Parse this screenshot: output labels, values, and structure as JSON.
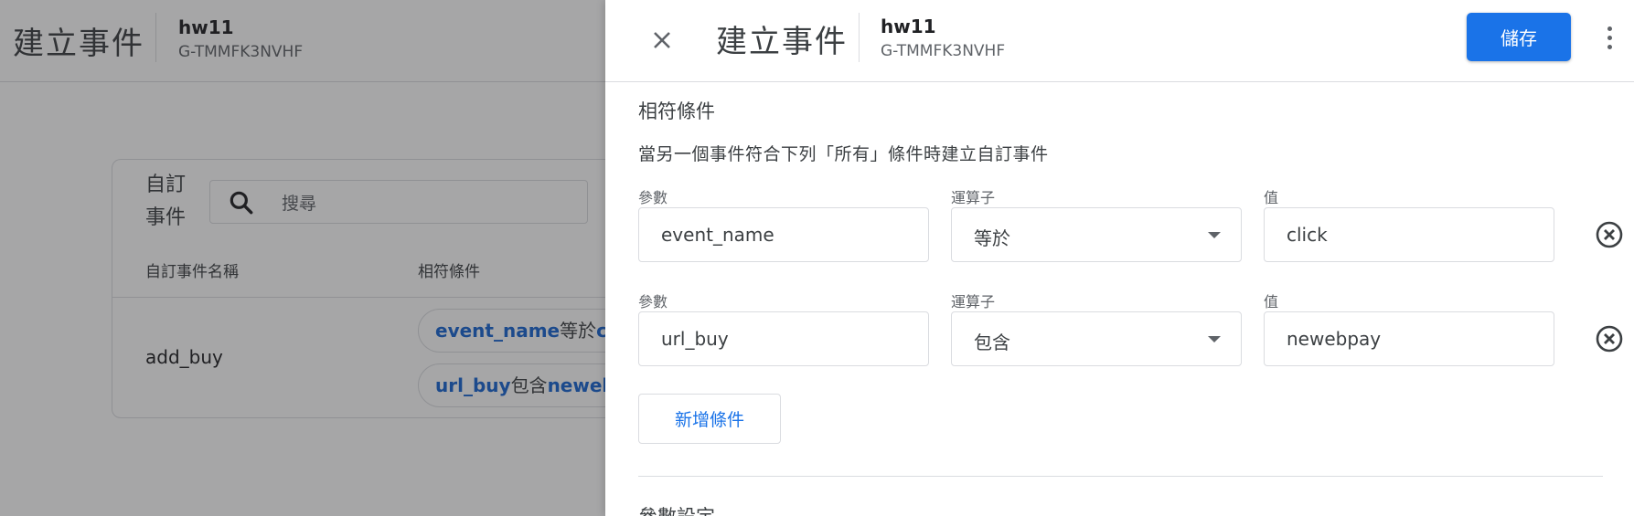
{
  "background": {
    "header": {
      "title": "建立事件",
      "property_name": "hw11",
      "property_id": "G-TMMFK3NVHF"
    },
    "card": {
      "title": "自訂事件",
      "search_placeholder": "搜尋",
      "columns": [
        "自訂事件名稱",
        "相符條件"
      ],
      "rows": [
        {
          "name": "add_buy",
          "conditions": [
            {
              "param": "event_name",
              "operator": "等於",
              "value": "clic"
            },
            {
              "param": "url_buy",
              "operator": "包含",
              "value": "newebp"
            }
          ]
        }
      ]
    }
  },
  "panel": {
    "header": {
      "close_icon": "close-icon",
      "title": "建立事件",
      "property_name": "hw11",
      "property_id": "G-TMMFK3NVHF",
      "save_label": "儲存",
      "more_icon": "more-vert-icon"
    },
    "matching": {
      "title": "相符條件",
      "description": "當另一個事件符合下列「所有」條件時建立自訂事件",
      "conditions": [
        {
          "param_label": "參數",
          "param_value": "event_name",
          "operator_label": "運算子",
          "operator_value": "等於",
          "value_label": "值",
          "value_value": "click"
        },
        {
          "param_label": "參數",
          "param_value": "url_buy",
          "operator_label": "運算子",
          "operator_value": "包含",
          "value_label": "值",
          "value_value": "newebpay"
        }
      ],
      "add_condition_label": "新增條件"
    },
    "next_section_title": "參數設定"
  },
  "colors": {
    "accent": "#1a73e8",
    "link": "#1967d2",
    "border": "#dadce0",
    "scrim": "rgba(32,33,36,0.40)"
  }
}
